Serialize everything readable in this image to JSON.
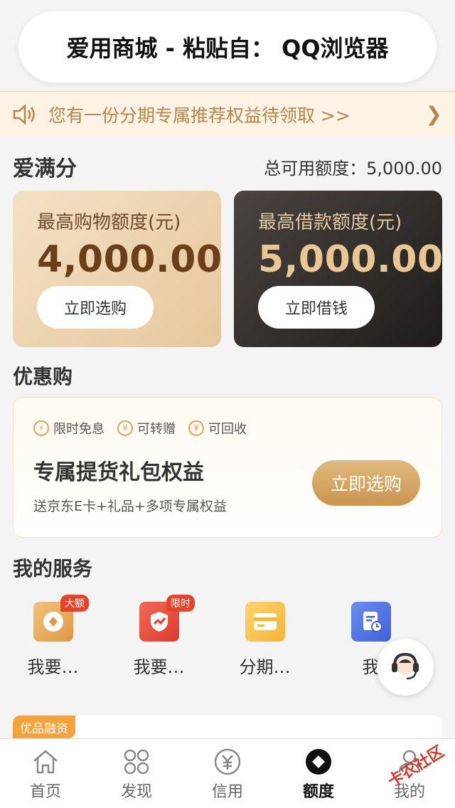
{
  "clipboard_toast": "爱用商城 - 粘贴自： QQ浏览器",
  "notice": {
    "text": "您有一份分期专属推荐权益待领取 >>",
    "chevron": "chevron-right-icon"
  },
  "score_section": {
    "title": "爱满分",
    "total_credit": "总可用额度：5,000.00"
  },
  "cards": [
    {
      "label": "最高购物额度(元)",
      "amount": "4,000.00",
      "button": "立即选购"
    },
    {
      "label": "最高借款额度(元)",
      "amount": "5,000.00",
      "button": "立即借钱"
    }
  ],
  "discount": {
    "title": "优惠购",
    "tags": [
      "限时免息",
      "可转赠",
      "可回收"
    ],
    "promo_title": "专属提货礼包权益",
    "promo_subtitle": "送京东E卡+礼品+多项专属权益",
    "promo_button": "立即选购"
  },
  "services": {
    "title": "我的服务",
    "items": [
      {
        "label": "我要…",
        "badge": "大额",
        "icon": "coin-wallet-icon"
      },
      {
        "label": "我要…",
        "badge": "限时",
        "icon": "shield-trend-icon"
      },
      {
        "label": "分期…",
        "badge": "",
        "icon": "card-icon"
      },
      {
        "label": "我",
        "badge": "",
        "icon": "document-clock-icon"
      }
    ]
  },
  "product_tag": "优品融资",
  "tabs": [
    {
      "label": "首页",
      "icon": "home-icon"
    },
    {
      "label": "发现",
      "icon": "grid-icon"
    },
    {
      "label": "信用",
      "icon": "yen-circle-icon"
    },
    {
      "label": "额度",
      "icon": "diamond-circle-icon",
      "active": true
    },
    {
      "label": "我的",
      "icon": "user-icon"
    }
  ],
  "watermark": "卡农社区",
  "colors": {
    "accent_gold": "#c9944f",
    "notice_bg": "#fdf3e4",
    "badge_red": "#e5442a"
  }
}
